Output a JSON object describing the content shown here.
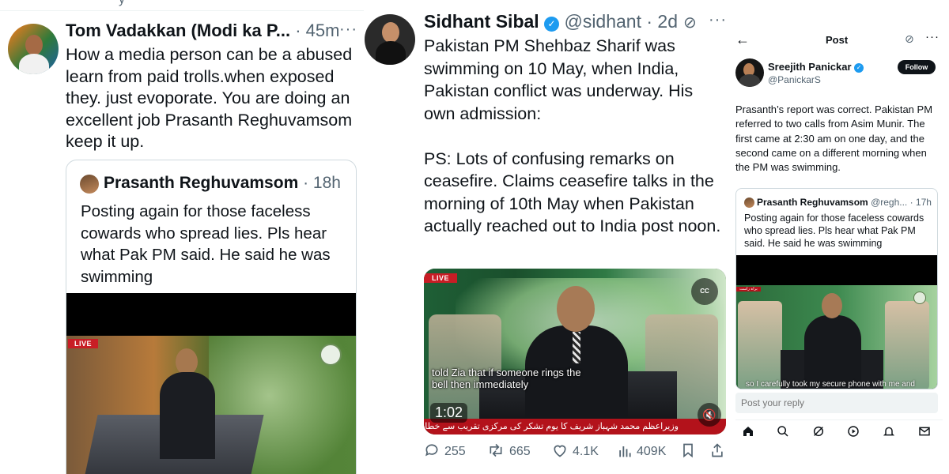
{
  "panel1": {
    "top_fragment": "y",
    "author_name": "Tom Vadakkan (Modi ka P...",
    "separator": "·",
    "time": "45m",
    "more_glyph": "···",
    "text": "How a media person can be a abused learn from paid trolls.when exposed they. just evoporate. You are doing an excellent job Prasanth Reghuvamsom keep it up.",
    "quote": {
      "author_name": "Prasanth Reghuvamsom",
      "meta": "· 18h",
      "text": "Posting again for those faceless cowards who spread lies. Pls hear what Pak PM said. He said he was swimming",
      "live_label": "LIVE"
    }
  },
  "panel2": {
    "author_name": "Sidhant Sibal",
    "verified_glyph": "✓",
    "handle_time": "@sidhant · 2d",
    "grok_glyph": "⊘",
    "more_glyph": "···",
    "text": "Pakistan PM Shehbaz Sharif was swimming on 10 May, when India, Pakistan conflict was underway. His own admission:\n\nPS: Lots of confusing remarks on ceasefire. Claims ceasefire talks in the morning of 10th May when Pakistan actually reached out to India post noon.",
    "video": {
      "live_label": "LIVE",
      "cc_label": "CC",
      "caption": "told Zia that if someone rings the\nbell then immediately",
      "duration": "1:02",
      "ticker": "وزیراعظم محمد شہباز شریف کا یوم تشکر کی مرکزی تقریب سے خطاب",
      "mute_glyph": "🔇"
    },
    "actions": {
      "replies": "255",
      "reposts": "665",
      "likes": "4.1K",
      "views": "409K",
      "icons": [
        "reply-icon",
        "repost-icon",
        "like-icon",
        "views-icon",
        "bookmark-icon",
        "share-icon"
      ]
    }
  },
  "panel3": {
    "back_glyph": "←",
    "title": "Post",
    "grok_glyph": "⊘",
    "more_glyph": "···",
    "author_name": "Sreejith Panickar",
    "verified_glyph": "✓",
    "handle": "@PanickarS",
    "follow_label": "Follow",
    "text": "Prasanth’s report was correct. Pakistan PM referred to two calls from Asim Munir. The first came at 2:30 am on one day, and the second came on a different morning when the PM was swimming.",
    "quote": {
      "author_name": "Prasanth Reghuvamsom",
      "meta": "@regh... · 17h",
      "text": "Posting again for those faceless cowards who spread lies. Pls hear what Pak PM said. He said he was swimming",
      "video_caption": "so I carefully took my secure phone with me and",
      "tag": "براہ راست"
    },
    "reply_placeholder": "Post your reply",
    "tabbar_icons": [
      "home-icon",
      "search-icon",
      "grok-icon",
      "play-icon",
      "notifications-icon",
      "messages-icon"
    ]
  },
  "colors": {
    "text_primary": "#0f1419",
    "text_secondary": "#536471",
    "verified_blue": "#1d9bf0",
    "live_red": "#c81d25",
    "border": "#cfd9de"
  }
}
